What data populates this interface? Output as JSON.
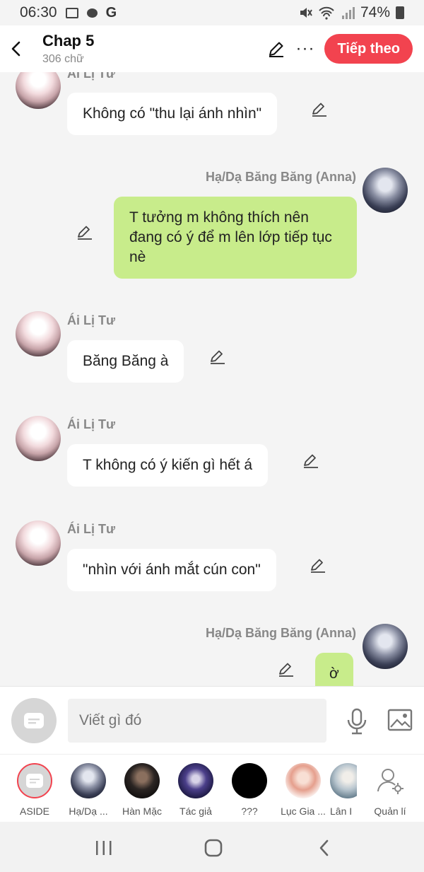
{
  "status_bar": {
    "time": "06:30",
    "battery": "74%"
  },
  "header": {
    "title": "Chap 5",
    "word_count": "306 chữ",
    "next_label": "Tiếp theo"
  },
  "messages": [
    {
      "side": "left",
      "name": "Ái Lị Tư",
      "text": "Không có \"thu lại ánh nhìn\""
    },
    {
      "side": "right",
      "name": "Hạ/Dạ Băng Băng (Anna)",
      "text": "T tưởng m không thích nên đang có ý để m lên lớp tiếp tục nè"
    },
    {
      "side": "left",
      "name": "Ái Lị Tư",
      "text": "Băng Băng à"
    },
    {
      "side": "left",
      "name": "Ái Lị Tư",
      "text": "T không có ý kiến gì hết á"
    },
    {
      "side": "left",
      "name": "Ái Lị Tư",
      "text": "\"nhìn với ánh mắt cún con\""
    },
    {
      "side": "right",
      "name": "Hạ/Dạ Băng Băng (Anna)",
      "text": "ờ"
    }
  ],
  "composer": {
    "placeholder": "Viết gì đó"
  },
  "characters": [
    {
      "label": "ASIDE"
    },
    {
      "label": "Hạ/Dạ ..."
    },
    {
      "label": "Hàn Mặc"
    },
    {
      "label": "Tác giả"
    },
    {
      "label": "???"
    },
    {
      "label": "Lục Gia ..."
    },
    {
      "label": "Lân I"
    },
    {
      "label": "Quản lí"
    }
  ],
  "colors": {
    "accent": "#f2434f",
    "own_bubble": "#c8ec8b",
    "other_bubble": "#ffffff",
    "background": "#f4f4f4"
  }
}
